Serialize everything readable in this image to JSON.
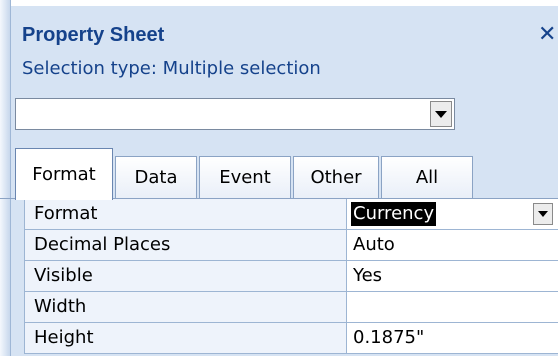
{
  "sheet": {
    "title": "Property Sheet",
    "close_icon": "close-icon",
    "selection_type": "Selection type:  Multiple selection",
    "dropdown_value": ""
  },
  "tabs": [
    {
      "label": "Format",
      "active": true
    },
    {
      "label": "Data",
      "active": false
    },
    {
      "label": "Event",
      "active": false
    },
    {
      "label": "Other",
      "active": false
    },
    {
      "label": "All",
      "active": false
    }
  ],
  "properties": [
    {
      "label": "Format",
      "value": "Currency"
    },
    {
      "label": "Decimal Places",
      "value": "Auto"
    },
    {
      "label": "Visible",
      "value": "Yes"
    },
    {
      "label": "Width",
      "value": ""
    },
    {
      "label": "Height",
      "value": "0.1875\""
    }
  ],
  "colors": {
    "title_blue": "#15428b",
    "panel_bg": "#d6e3f3",
    "label_bg": "#eef3fb"
  }
}
